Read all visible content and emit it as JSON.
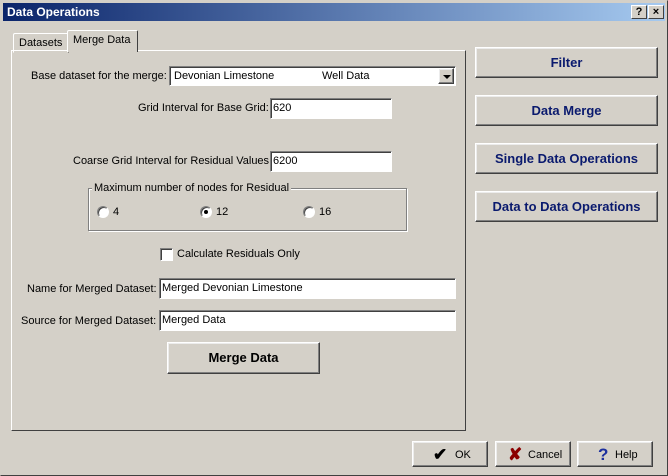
{
  "window": {
    "title": "Data Operations",
    "help_glyph": "?",
    "close_glyph": "×"
  },
  "tabs": [
    {
      "label": "Datasets"
    },
    {
      "label": "Merge Data"
    }
  ],
  "merge": {
    "base_dataset_label": "Base dataset for the merge:",
    "base_dataset_name": "Devonian Limestone",
    "base_dataset_type": "Well Data",
    "grid_interval_label": "Grid Interval for Base Grid:",
    "grid_interval_value": "620",
    "coarse_grid_label": "Coarse Grid Interval for Residual Values:",
    "coarse_grid_value": "6200",
    "nodes_group_title": "Maximum number of nodes for Residual",
    "nodes_options": [
      "4",
      "12",
      "16"
    ],
    "nodes_selected": "12",
    "calc_residuals_label": "Calculate Residuals Only",
    "calc_residuals_checked": false,
    "name_label": "Name for Merged Dataset:",
    "name_value": "Merged Devonian Limestone",
    "source_label": "Source for Merged Dataset:",
    "source_value": "Merged Data",
    "merge_button": "Merge Data"
  },
  "side_buttons": {
    "filter": "Filter",
    "data_merge": "Data Merge",
    "single_ops": "Single Data Operations",
    "data_to_data": "Data to  Data Operations"
  },
  "footer": {
    "ok": "OK",
    "cancel": "Cancel",
    "help": "Help",
    "ok_icon": "✔",
    "cancel_icon": "✘",
    "help_icon": "?"
  },
  "colors": {
    "title_start": "#0a246a",
    "title_end": "#a6caf0",
    "side_button_text": "#0a1a6e",
    "cancel_icon": "#8b0000",
    "help_icon": "#1c2f9e"
  }
}
